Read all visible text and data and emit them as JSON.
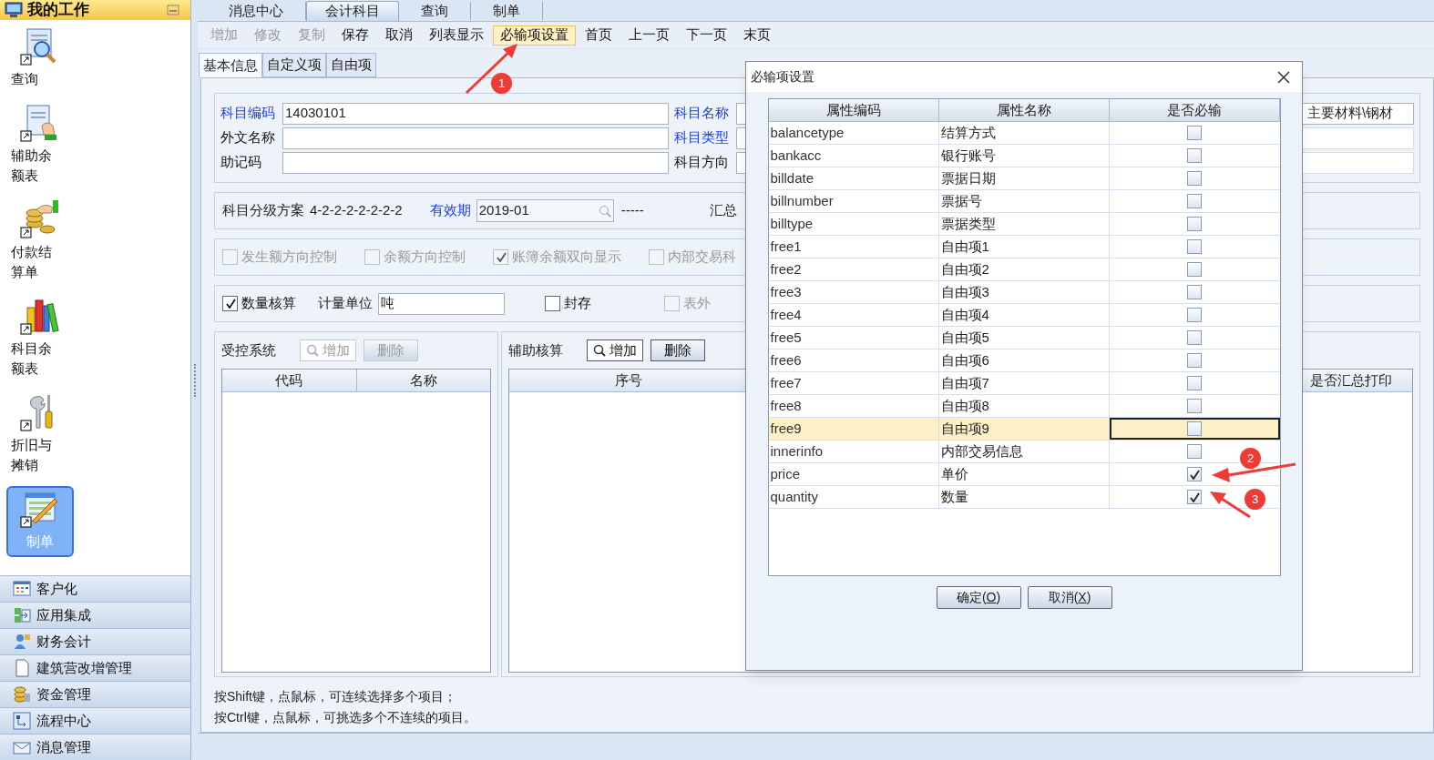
{
  "sidebar": {
    "title": "我的工作",
    "items": [
      {
        "label": "查询",
        "selected": false
      },
      {
        "label": "辅助余额表",
        "selected": false
      },
      {
        "label": "付款结算单",
        "selected": false
      },
      {
        "label": "科目余额表",
        "selected": false
      },
      {
        "label": "折旧与摊销",
        "selected": false
      },
      {
        "label": "制单",
        "selected": true
      }
    ],
    "modules": [
      "客户化",
      "应用集成",
      "财务会计",
      "建筑营改增管理",
      "资金管理",
      "流程中心",
      "消息管理"
    ]
  },
  "tabs": [
    {
      "label": "消息中心",
      "selected": false
    },
    {
      "label": "会计科目",
      "selected": true
    },
    {
      "label": "查询",
      "selected": false
    },
    {
      "label": "制单",
      "selected": false
    }
  ],
  "toolbar": [
    {
      "label": "增加",
      "disabled": true,
      "highlighted": false
    },
    {
      "label": "修改",
      "disabled": true,
      "highlighted": false
    },
    {
      "label": "复制",
      "disabled": true,
      "highlighted": false
    },
    {
      "label": "保存",
      "disabled": false,
      "highlighted": false
    },
    {
      "label": "取消",
      "disabled": false,
      "highlighted": false
    },
    {
      "label": "列表显示",
      "disabled": false,
      "highlighted": false
    },
    {
      "label": "必输项设置",
      "disabled": false,
      "highlighted": true
    },
    {
      "label": "首页",
      "disabled": false,
      "highlighted": false
    },
    {
      "label": "上一页",
      "disabled": false,
      "highlighted": false
    },
    {
      "label": "下一页",
      "disabled": false,
      "highlighted": false
    },
    {
      "label": "末页",
      "disabled": false,
      "highlighted": false
    }
  ],
  "subtabs": [
    {
      "label": "基本信息",
      "selected": true
    },
    {
      "label": "自定义项",
      "selected": false
    },
    {
      "label": "自由项",
      "selected": false
    }
  ],
  "form": {
    "rows": [
      {
        "fields": [
          {
            "label": "科目编码",
            "required": true,
            "value": "14030101"
          },
          {
            "label": "科目名称",
            "required": true
          }
        ],
        "extra": "主要材料\\钢材"
      },
      {
        "fields": [
          {
            "label": "外文名称",
            "required": false
          },
          {
            "label": "科目类型",
            "required": true
          }
        ]
      },
      {
        "fields": [
          {
            "label": "助记码",
            "required": false
          },
          {
            "label": "科目方向",
            "required": false
          }
        ]
      }
    ],
    "scheme_label": "科目分级方案",
    "scheme": "4-2-2-2-2-2-2-2",
    "period_label": "有效期",
    "period": "2019-01",
    "dash": "-----",
    "summary_label": "汇总",
    "options": [
      {
        "label": "发生额方向控制",
        "checked": false,
        "disabled": true
      },
      {
        "label": "余额方向控制",
        "checked": false,
        "disabled": true
      },
      {
        "label": "账簿余额双向显示",
        "checked": true,
        "disabled": true
      },
      {
        "label": "内部交易科",
        "checked": false,
        "disabled": true
      }
    ],
    "options2": [
      {
        "kind": "checkbox",
        "label": "数量核算",
        "checked": true,
        "disabled": false
      },
      {
        "kind": "field",
        "label": "计量单位",
        "value": "吨"
      },
      {
        "kind": "checkbox",
        "label": "封存",
        "checked": false,
        "disabled": false
      },
      {
        "kind": "checkbox",
        "label": "表外",
        "checked": false,
        "disabled": true
      }
    ]
  },
  "panels": [
    {
      "title": "受控系统",
      "buttons": [
        {
          "label": "增加",
          "kind": "search",
          "disabled": true
        },
        {
          "label": "删除",
          "kind": "plain",
          "disabled": true
        }
      ],
      "columns": [
        "代码",
        "名称"
      ]
    },
    {
      "title": "辅助核算",
      "buttons": [
        {
          "label": "增加",
          "kind": "search",
          "disabled": false
        },
        {
          "label": "删除",
          "kind": "plain",
          "disabled": false
        }
      ],
      "columns": [
        "序号",
        "是否汇总打印"
      ]
    }
  ],
  "notes": [
    "按Shift键，点鼠标，可连续选择多个项目；",
    "按Ctrl键，点鼠标，可挑选多个不连续的项目。"
  ],
  "dialog": {
    "title": "必输项设置",
    "columns": [
      "属性编码",
      "属性名称",
      "是否必输"
    ],
    "rows": [
      {
        "code": "balancetype",
        "name": "结算方式",
        "required": false,
        "selected": false
      },
      {
        "code": "bankacc",
        "name": "银行账号",
        "required": false,
        "selected": false
      },
      {
        "code": "billdate",
        "name": "票据日期",
        "required": false,
        "selected": false
      },
      {
        "code": "billnumber",
        "name": "票据号",
        "required": false,
        "selected": false
      },
      {
        "code": "billtype",
        "name": "票据类型",
        "required": false,
        "selected": false
      },
      {
        "code": "free1",
        "name": "自由项1",
        "required": false,
        "selected": false
      },
      {
        "code": "free2",
        "name": "自由项2",
        "required": false,
        "selected": false
      },
      {
        "code": "free3",
        "name": "自由项3",
        "required": false,
        "selected": false
      },
      {
        "code": "free4",
        "name": "自由项4",
        "required": false,
        "selected": false
      },
      {
        "code": "free5",
        "name": "自由项5",
        "required": false,
        "selected": false
      },
      {
        "code": "free6",
        "name": "自由项6",
        "required": false,
        "selected": false
      },
      {
        "code": "free7",
        "name": "自由项7",
        "required": false,
        "selected": false
      },
      {
        "code": "free8",
        "name": "自由项8",
        "required": false,
        "selected": false
      },
      {
        "code": "free9",
        "name": "自由项9",
        "required": false,
        "selected": true
      },
      {
        "code": "innerinfo",
        "name": "内部交易信息",
        "required": false,
        "selected": false
      },
      {
        "code": "price",
        "name": "单价",
        "required": true,
        "selected": false
      },
      {
        "code": "quantity",
        "name": "数量",
        "required": true,
        "selected": false
      }
    ],
    "buttons": [
      "确定(O)",
      "取消(X)"
    ]
  },
  "annotations": [
    "1",
    "2",
    "3"
  ]
}
